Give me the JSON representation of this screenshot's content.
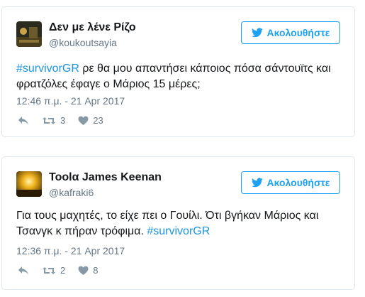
{
  "tweets": [
    {
      "display_name": "Δεν με λένε Ρίζο",
      "screen_name": "@koukoutsayia",
      "follow_label": "Ακολουθήστε",
      "text_hashtag": "#survivorGR",
      "text_body": " ρε θα μου απαντήσει κάποιος πόσα σάντουϊτς και φρατζόλες έφαγε ο Μάριος 15 μέρες;",
      "timestamp": "12:46 π.μ. - 21 Apr 2017",
      "retweets": "3",
      "likes": "23",
      "avatar_icon": "avatar-dark-photo"
    },
    {
      "display_name": "Toolα James Keenan",
      "screen_name": "@kafraki6",
      "follow_label": "Ακολουθήστε",
      "text_body": "Για τους μαχητές, το είχε πει ο Γουίλι. Ότι βγήκαν Μάριος και Τσανγκ κ πήραν τρόφιμα. ",
      "text_hashtag": "#survivorGR",
      "timestamp": "12:36 π.μ. - 21 Apr 2017",
      "retweets": "2",
      "likes": "8",
      "avatar_icon": "avatar-sunset-photo"
    }
  ],
  "icons": {
    "reply": "reply-icon",
    "retweet": "retweet-icon",
    "like": "heart-icon",
    "follow": "twitter-bird-icon"
  },
  "colors": {
    "accent": "#1da1f2",
    "hashtag": "#1b95e0",
    "muted": "#657786",
    "text": "#14171a",
    "border": "#e1e8ed"
  }
}
